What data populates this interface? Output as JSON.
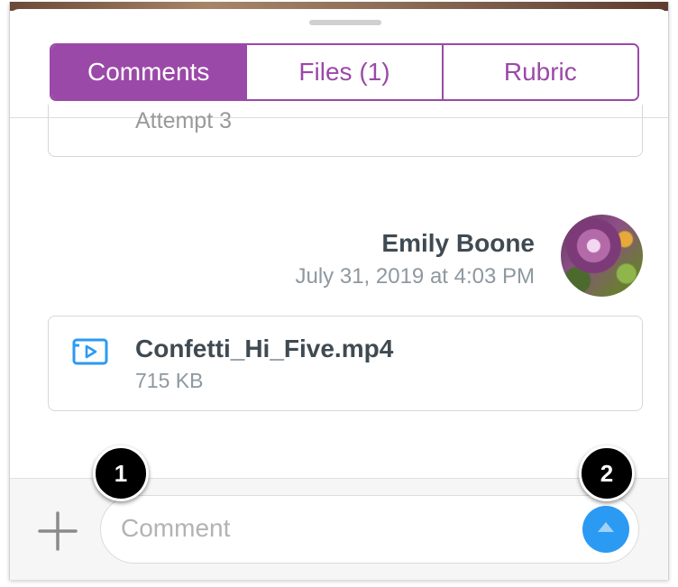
{
  "tabs": [
    {
      "label": "Comments",
      "active": true
    },
    {
      "label": "Files (1)",
      "active": false
    },
    {
      "label": "Rubric",
      "active": false
    }
  ],
  "submission": {
    "attempt_label": "Attempt 3"
  },
  "comment": {
    "author": "Emily Boone",
    "timestamp": "July 31, 2019 at 4:03 PM",
    "attachment": {
      "icon": "video-file-icon",
      "name": "Confetti_Hi_Five.mp4",
      "size": "715 KB"
    }
  },
  "composer": {
    "placeholder": "Comment",
    "value": "",
    "add_icon": "plus-icon",
    "send_icon": "send-arrow-icon"
  },
  "callouts": [
    "1",
    "2"
  ],
  "colors": {
    "accent": "#9b49a8",
    "send": "#2b9af3",
    "icon_blue": "#2b9af3",
    "text_dark": "#3f4a52",
    "text_muted": "#8e98a0"
  }
}
